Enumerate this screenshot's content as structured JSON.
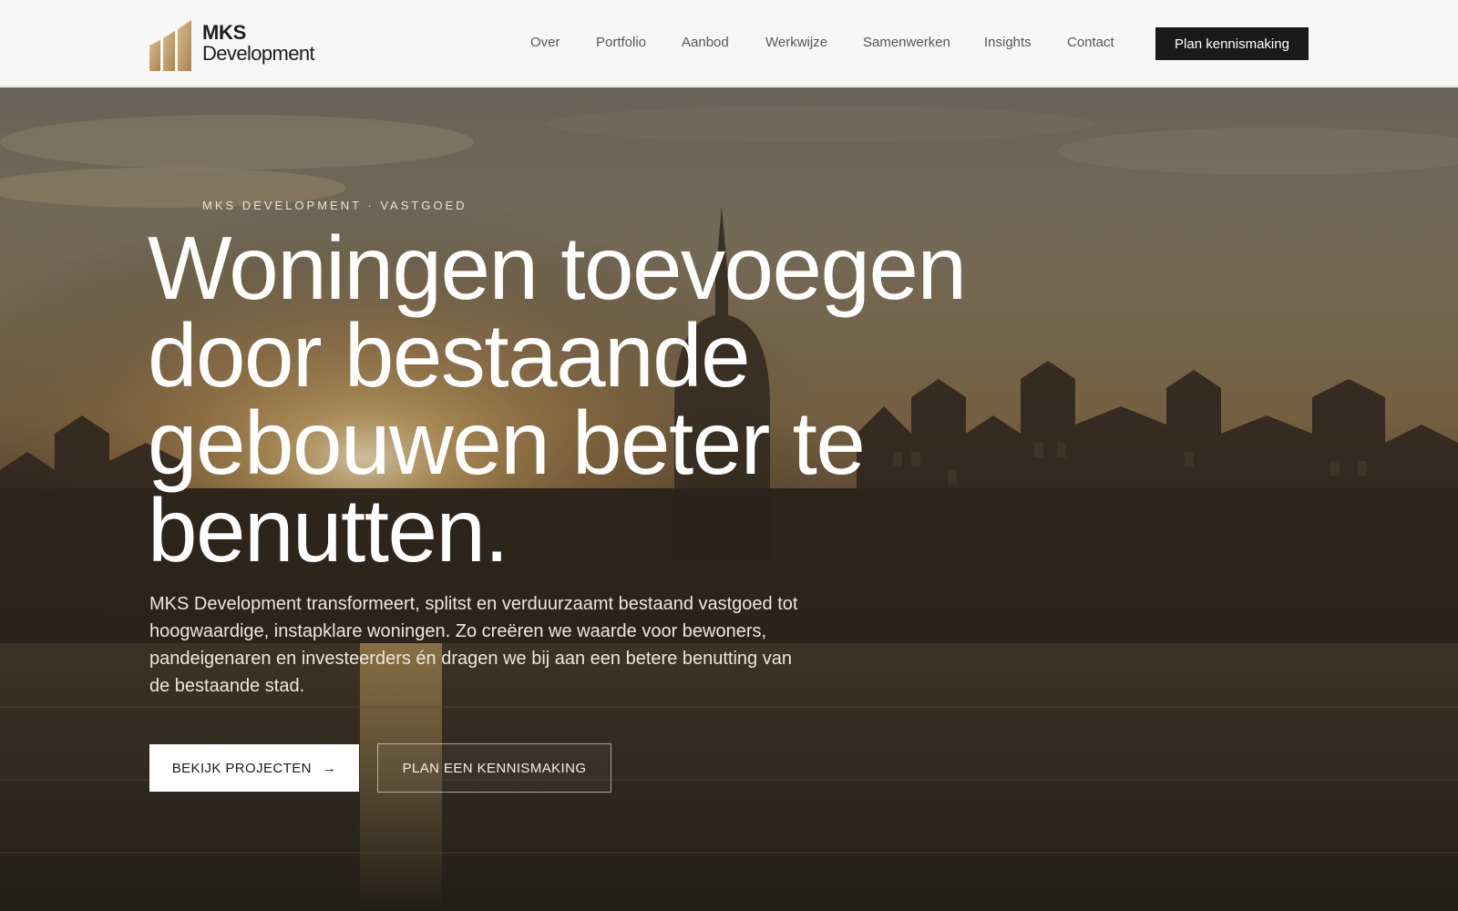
{
  "brand": {
    "name_line1": "MKS",
    "name_line2": "Development",
    "logo_icon": "building-bars-icon",
    "logo_color": "#c2a070"
  },
  "nav": {
    "items": [
      {
        "label": "Over"
      },
      {
        "label": "Portfolio"
      },
      {
        "label": "Aanbod"
      },
      {
        "label": "Werkwijze"
      },
      {
        "label": "Samenwerken"
      },
      {
        "label": "Insights"
      },
      {
        "label": "Contact"
      }
    ],
    "cta_label": "Plan kennismaking"
  },
  "hero": {
    "eyebrow": "MKS DEVELOPMENT · VASTGOED",
    "headline": "Woningen toevoegen door bestaande gebouwen beter te benutten.",
    "lede": "MKS Development transformeert, splitst en verduurzaamt bestaand vastgoed tot hoogwaardige, instapklare woningen. Zo creëren we waarde voor bewoners, pandeigenaren en investeerders én dragen we bij aan een betere benutting van de bestaande stad.",
    "primary_button": "BEKIJK PROJECTEN",
    "primary_button_icon": "arrow-right-icon",
    "secondary_button": "PLAN EEN KENNISMAKING",
    "background": "sunset-city-skyline-over-water"
  },
  "colors": {
    "header_bg": "#f7f7f7",
    "cta_bg": "#1a1a1a",
    "accent_gold": "#c2a070"
  }
}
